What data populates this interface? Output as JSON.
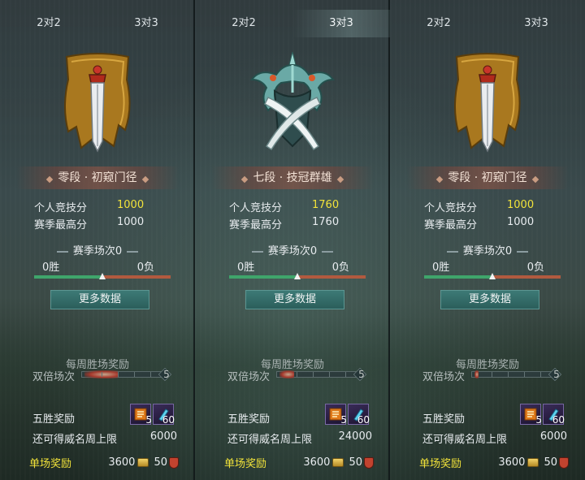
{
  "panels": [
    {
      "tabs": [
        "2对2",
        "3对3"
      ],
      "active_tab": 1,
      "emblem": "golden-banner-sword-icon",
      "rank": "零段 · 初窥门径",
      "personal_label": "个人竞技分",
      "personal_score": "1000",
      "season_high_label": "赛季最高分",
      "season_high": "1000",
      "season_matches": "赛季场次0",
      "wins": "0胜",
      "losses": "0负",
      "win_fraction": 0.5,
      "more_button": "更多数据",
      "weekly_title": "每周胜场奖励",
      "double_label": "双倍场次",
      "double_count": "5",
      "double_fill": 0.45,
      "five_win_label": "五胜奖励",
      "item1_count": "5",
      "item2_count": "60",
      "cap_label": "还可得威名周上限",
      "cap_value": "6000",
      "single_label": "单场奖励",
      "single_coin": "3600",
      "single_shield": "50"
    },
    {
      "tabs": [
        "2对2",
        "3对3"
      ],
      "active_tab": 1,
      "emblem": "jade-crossed-blades-crest-icon",
      "rank": "七段 · 技冠群雄",
      "personal_label": "个人竞技分",
      "personal_score": "1760",
      "season_high_label": "赛季最高分",
      "season_high": "1760",
      "season_matches": "赛季场次0",
      "wins": "0胜",
      "losses": "0负",
      "win_fraction": 0.5,
      "more_button": "更多数据",
      "weekly_title": "每周胜场奖励",
      "double_label": "双倍场次",
      "double_count": "5",
      "double_fill": 0.2,
      "five_win_label": "五胜奖励",
      "item1_count": "5",
      "item2_count": "60",
      "cap_label": "还可得威名周上限",
      "cap_value": "24000",
      "single_label": "单场奖励",
      "single_coin": "3600",
      "single_shield": "50"
    },
    {
      "tabs": [
        "2对2",
        "3对3"
      ],
      "active_tab": 1,
      "emblem": "golden-banner-sword-icon",
      "rank": "零段 · 初窥门径",
      "personal_label": "个人竞技分",
      "personal_score": "1000",
      "season_high_label": "赛季最高分",
      "season_high": "1000",
      "season_matches": "赛季场次0",
      "wins": "0胜",
      "losses": "0负",
      "win_fraction": 0.5,
      "more_button": "更多数据",
      "weekly_title": "每周胜场奖励",
      "double_label": "双倍场次",
      "double_count": "5",
      "double_fill": 0.05,
      "five_win_label": "五胜奖励",
      "item1_count": "5",
      "item2_count": "60",
      "cap_label": "还可得威名周上限",
      "cap_value": "6000",
      "single_label": "单场奖励",
      "single_coin": "3600",
      "single_shield": "50"
    }
  ],
  "colors": {
    "highlight": "#f2e33a",
    "win_bar": "#3fa56b",
    "lose_bar": "#b15a3f",
    "button": "#2b5e5b"
  }
}
